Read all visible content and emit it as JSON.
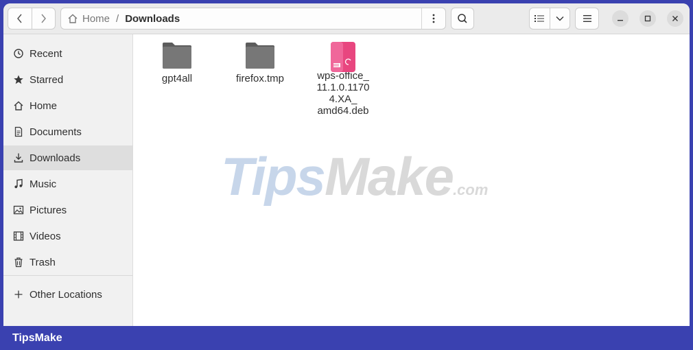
{
  "header": {
    "breadcrumb": [
      {
        "label": "Home"
      },
      {
        "label": "Downloads"
      }
    ],
    "icons": {
      "back": "chevron-left-icon",
      "forward": "chevron-right-icon",
      "home": "home-icon",
      "path_menu": "vertical-dots-icon",
      "search": "search-icon",
      "list_view": "list-view-icon",
      "view_options": "chevron-down-icon",
      "main_menu": "hamburger-menu-icon",
      "minimize": "minimize-icon",
      "maximize": "maximize-icon",
      "close": "close-icon"
    }
  },
  "sidebar": {
    "items": [
      {
        "label": "Recent",
        "icon": "clock-icon",
        "active": false
      },
      {
        "label": "Starred",
        "icon": "star-icon",
        "active": false
      },
      {
        "label": "Home",
        "icon": "home-icon",
        "active": false
      },
      {
        "label": "Documents",
        "icon": "document-icon",
        "active": false
      },
      {
        "label": "Downloads",
        "icon": "download-icon",
        "active": true
      },
      {
        "label": "Music",
        "icon": "music-icon",
        "active": false
      },
      {
        "label": "Pictures",
        "icon": "picture-icon",
        "active": false
      },
      {
        "label": "Videos",
        "icon": "video-icon",
        "active": false
      },
      {
        "label": "Trash",
        "icon": "trash-icon",
        "active": false
      }
    ],
    "other": {
      "label": "Other Locations",
      "icon": "plus-icon"
    }
  },
  "files": [
    {
      "name": "gpt4all",
      "type": "folder"
    },
    {
      "name": "firefox.tmp",
      "type": "folder"
    },
    {
      "name": "wps-office_\n11.1.0.1170\n4.XA_\namd64.deb",
      "type": "deb-package"
    }
  ],
  "watermark": {
    "part1": "Tips",
    "part2": "Make",
    "part3": ".com"
  },
  "footer": {
    "brand": "TipsMake"
  },
  "colors": {
    "accent_bar": "#3a41b0",
    "folder": "#6e6e6e",
    "deb_package": "#e8467f"
  }
}
